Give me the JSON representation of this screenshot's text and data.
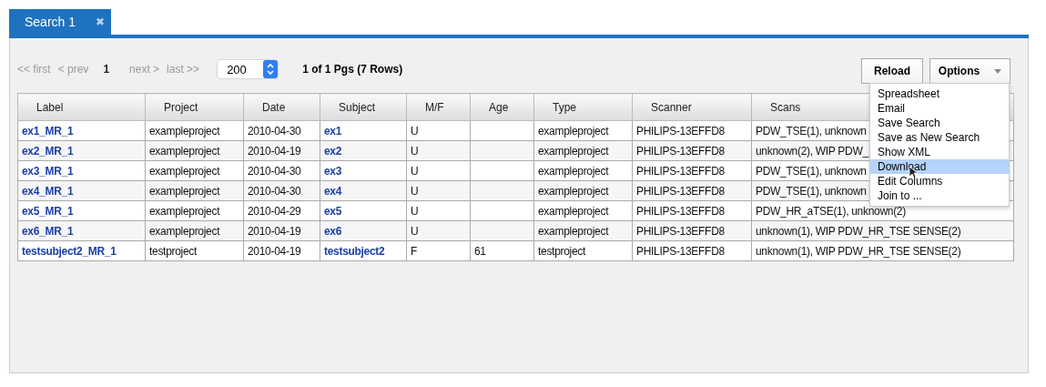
{
  "tabs": [
    {
      "label": "Search 1",
      "close": "✖",
      "selected": true
    }
  ],
  "pager": {
    "first": "<< first",
    "prev": "< prev",
    "current": "1",
    "next": "next >",
    "last": "last >>",
    "page_size": "200",
    "summary": "1 of 1 Pgs (7 Rows)"
  },
  "buttons": {
    "reload": "Reload",
    "options": "Options"
  },
  "table": {
    "columns": [
      {
        "label": "Label",
        "kind": "link"
      },
      {
        "label": "Project",
        "kind": "text"
      },
      {
        "label": "Date",
        "kind": "text"
      },
      {
        "label": "Subject",
        "kind": "link"
      },
      {
        "label": "M/F",
        "kind": "text"
      },
      {
        "label": "Age",
        "kind": "text"
      },
      {
        "label": "Type",
        "kind": "text"
      },
      {
        "label": "Scanner",
        "kind": "text"
      },
      {
        "label": "Scans",
        "kind": "text"
      }
    ],
    "rows": [
      [
        "ex1_MR_1",
        "exampleproject",
        "2010-04-30",
        "ex1",
        "U",
        "",
        "exampleproject",
        "PHILIPS-13EFFD8",
        "PDW_TSE(1), unknown"
      ],
      [
        "ex2_MR_1",
        "exampleproject",
        "2010-04-19",
        "ex2",
        "U",
        "",
        "exampleproject",
        "PHILIPS-13EFFD8",
        "unknown(2), WIP PDW_"
      ],
      [
        "ex3_MR_1",
        "exampleproject",
        "2010-04-30",
        "ex3",
        "U",
        "",
        "exampleproject",
        "PHILIPS-13EFFD8",
        "PDW_TSE(1), unknown"
      ],
      [
        "ex4_MR_1",
        "exampleproject",
        "2010-04-30",
        "ex4",
        "U",
        "",
        "exampleproject",
        "PHILIPS-13EFFD8",
        "PDW_TSE(1), unknown"
      ],
      [
        "ex5_MR_1",
        "exampleproject",
        "2010-04-29",
        "ex5",
        "U",
        "",
        "exampleproject",
        "PHILIPS-13EFFD8",
        "PDW_HR_aTSE(1), unknown(2)"
      ],
      [
        "ex6_MR_1",
        "exampleproject",
        "2010-04-19",
        "ex6",
        "U",
        "",
        "exampleproject",
        "PHILIPS-13EFFD8",
        "unknown(1), WIP PDW_HR_TSE SENSE(2)"
      ],
      [
        "testsubject2_MR_1",
        "testproject",
        "2010-04-19",
        "testsubject2",
        "F",
        "61",
        "testproject",
        "PHILIPS-13EFFD8",
        "unknown(1), WIP PDW_HR_TSE SENSE(2)"
      ]
    ]
  },
  "options_menu": [
    {
      "label": "Spreadsheet",
      "selected": false
    },
    {
      "label": "Email",
      "selected": false
    },
    {
      "label": "Save Search",
      "selected": false
    },
    {
      "label": "Save as New Search",
      "selected": false
    },
    {
      "label": "Show XML",
      "selected": false
    },
    {
      "label": "Download",
      "selected": true
    },
    {
      "label": "Edit Columns",
      "selected": false
    },
    {
      "label": "Join to ...",
      "selected": false
    }
  ]
}
